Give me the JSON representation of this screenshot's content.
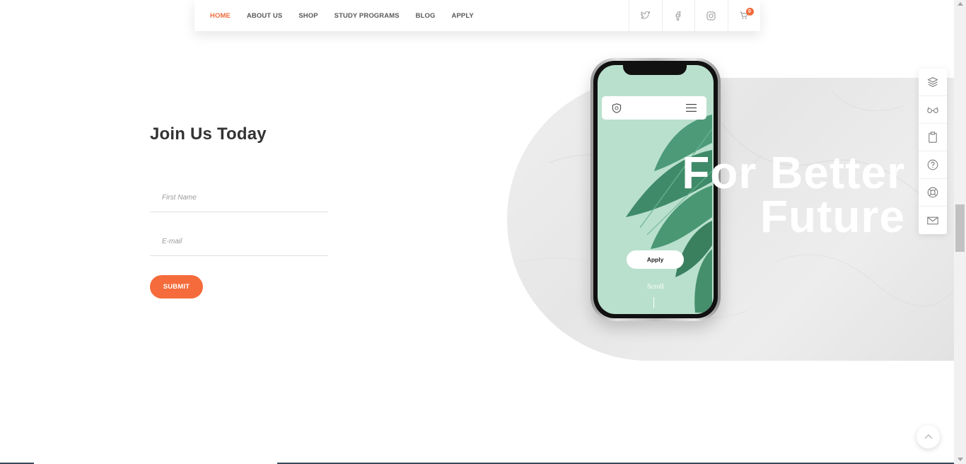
{
  "nav": {
    "links": [
      {
        "label": "HOME",
        "active": true
      },
      {
        "label": "ABOUT US",
        "active": false
      },
      {
        "label": "SHOP",
        "active": false
      },
      {
        "label": "STUDY PROGRAMS",
        "active": false
      },
      {
        "label": "BLOG",
        "active": false
      },
      {
        "label": "APPLY",
        "active": false
      }
    ],
    "icons": [
      "twitter-icon",
      "facebook-icon",
      "instagram-icon",
      "cart-icon"
    ],
    "cart_count": "0"
  },
  "form": {
    "title": "Join Us Today",
    "first_name_placeholder": "First Name",
    "email_placeholder": "E-mail",
    "submit_label": "SUBMIT"
  },
  "hero": {
    "line1": "For Better",
    "line2": "Future",
    "phone": {
      "apply_label": "Apply",
      "scroll_label": "Scroll"
    }
  },
  "side_toolbar": {
    "icons": [
      "layers-icon",
      "glasses-icon",
      "clipboard-icon",
      "help-icon",
      "lifebuoy-icon",
      "mail-icon"
    ]
  },
  "colors": {
    "accent": "#f26b3a",
    "text": "#333333",
    "phone_screen": "#b9e0cd",
    "marble": "#e8e8e8"
  }
}
